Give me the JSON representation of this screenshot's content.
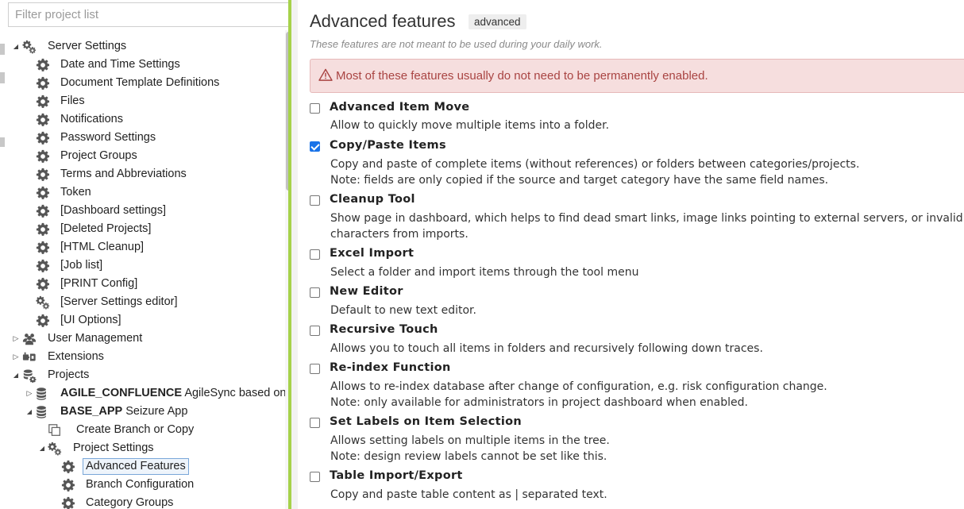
{
  "filter": {
    "placeholder": "Filter project list"
  },
  "tree": {
    "server_settings": "Server Settings",
    "children": [
      "Date and Time Settings",
      "Document Template Definitions",
      "Files",
      "Notifications",
      "Password Settings",
      "Project Groups",
      "Terms and Abbreviations",
      "Token",
      "[Dashboard settings]",
      "[Deleted Projects]",
      "[HTML Cleanup]",
      "[Job list]",
      "[PRINT Config]",
      "[Server Settings editor]",
      "[UI Options]"
    ],
    "user_management": "User Management",
    "extensions": "Extensions",
    "projects": "Projects",
    "agile_key": "AGILE_CONFLUENCE",
    "agile_name": "AgileSync based on a",
    "base_key": "BASE_APP",
    "base_name": "Seizure App",
    "create_branch": "Create Branch or Copy",
    "project_settings": "Project Settings",
    "advanced_features": "Advanced Features",
    "branch_configuration": "Branch Configuration",
    "category_groups": "Category Groups"
  },
  "main": {
    "title": "Advanced features",
    "badge": "advanced",
    "subtitle": "These features are not meant to be used during your daily work.",
    "alert": "Most of these features usually do not need to be permanently enabled.",
    "features": [
      {
        "title": "Advanced Item Move",
        "checked": false,
        "desc1": "Allow to quickly move multiple items into a folder.",
        "desc2": ""
      },
      {
        "title": "Copy/Paste Items",
        "checked": true,
        "desc1": "Copy and paste of complete items (without references) or folders between categories/projects.",
        "desc2": "Note: fields are only copied if the source and target category have the same field names."
      },
      {
        "title": "Cleanup Tool",
        "checked": false,
        "desc1": "Show page in dashboard, which helps to find dead smart links, image links pointing to external servers, or invalid",
        "desc2": "characters from imports."
      },
      {
        "title": "Excel Import",
        "checked": false,
        "desc1": "Select a folder and import items through the tool menu",
        "desc2": ""
      },
      {
        "title": "New Editor",
        "checked": false,
        "desc1": "Default to new text editor.",
        "desc2": ""
      },
      {
        "title": "Recursive Touch",
        "checked": false,
        "desc1": "Allows you to touch all items in folders and recursively following down traces.",
        "desc2": ""
      },
      {
        "title": "Re-index Function",
        "checked": false,
        "desc1": "Allows to re-index database after change of configuration, e.g. risk configuration change.",
        "desc2": "Note: only available for administrators in project dashboard when enabled."
      },
      {
        "title": "Set Labels on Item Selection",
        "checked": false,
        "desc1": "Allows setting labels on multiple items in the tree.",
        "desc2": "Note: design review labels cannot be set like this."
      },
      {
        "title": "Table Import/Export",
        "checked": false,
        "desc1": "Copy and paste table content as | separated text.",
        "desc2": ""
      }
    ]
  },
  "colors": {
    "accent": "#a6d24a",
    "alert_bg": "#f6dede",
    "alert_text": "#a94442",
    "checkbox_on": "#1a73e8"
  }
}
